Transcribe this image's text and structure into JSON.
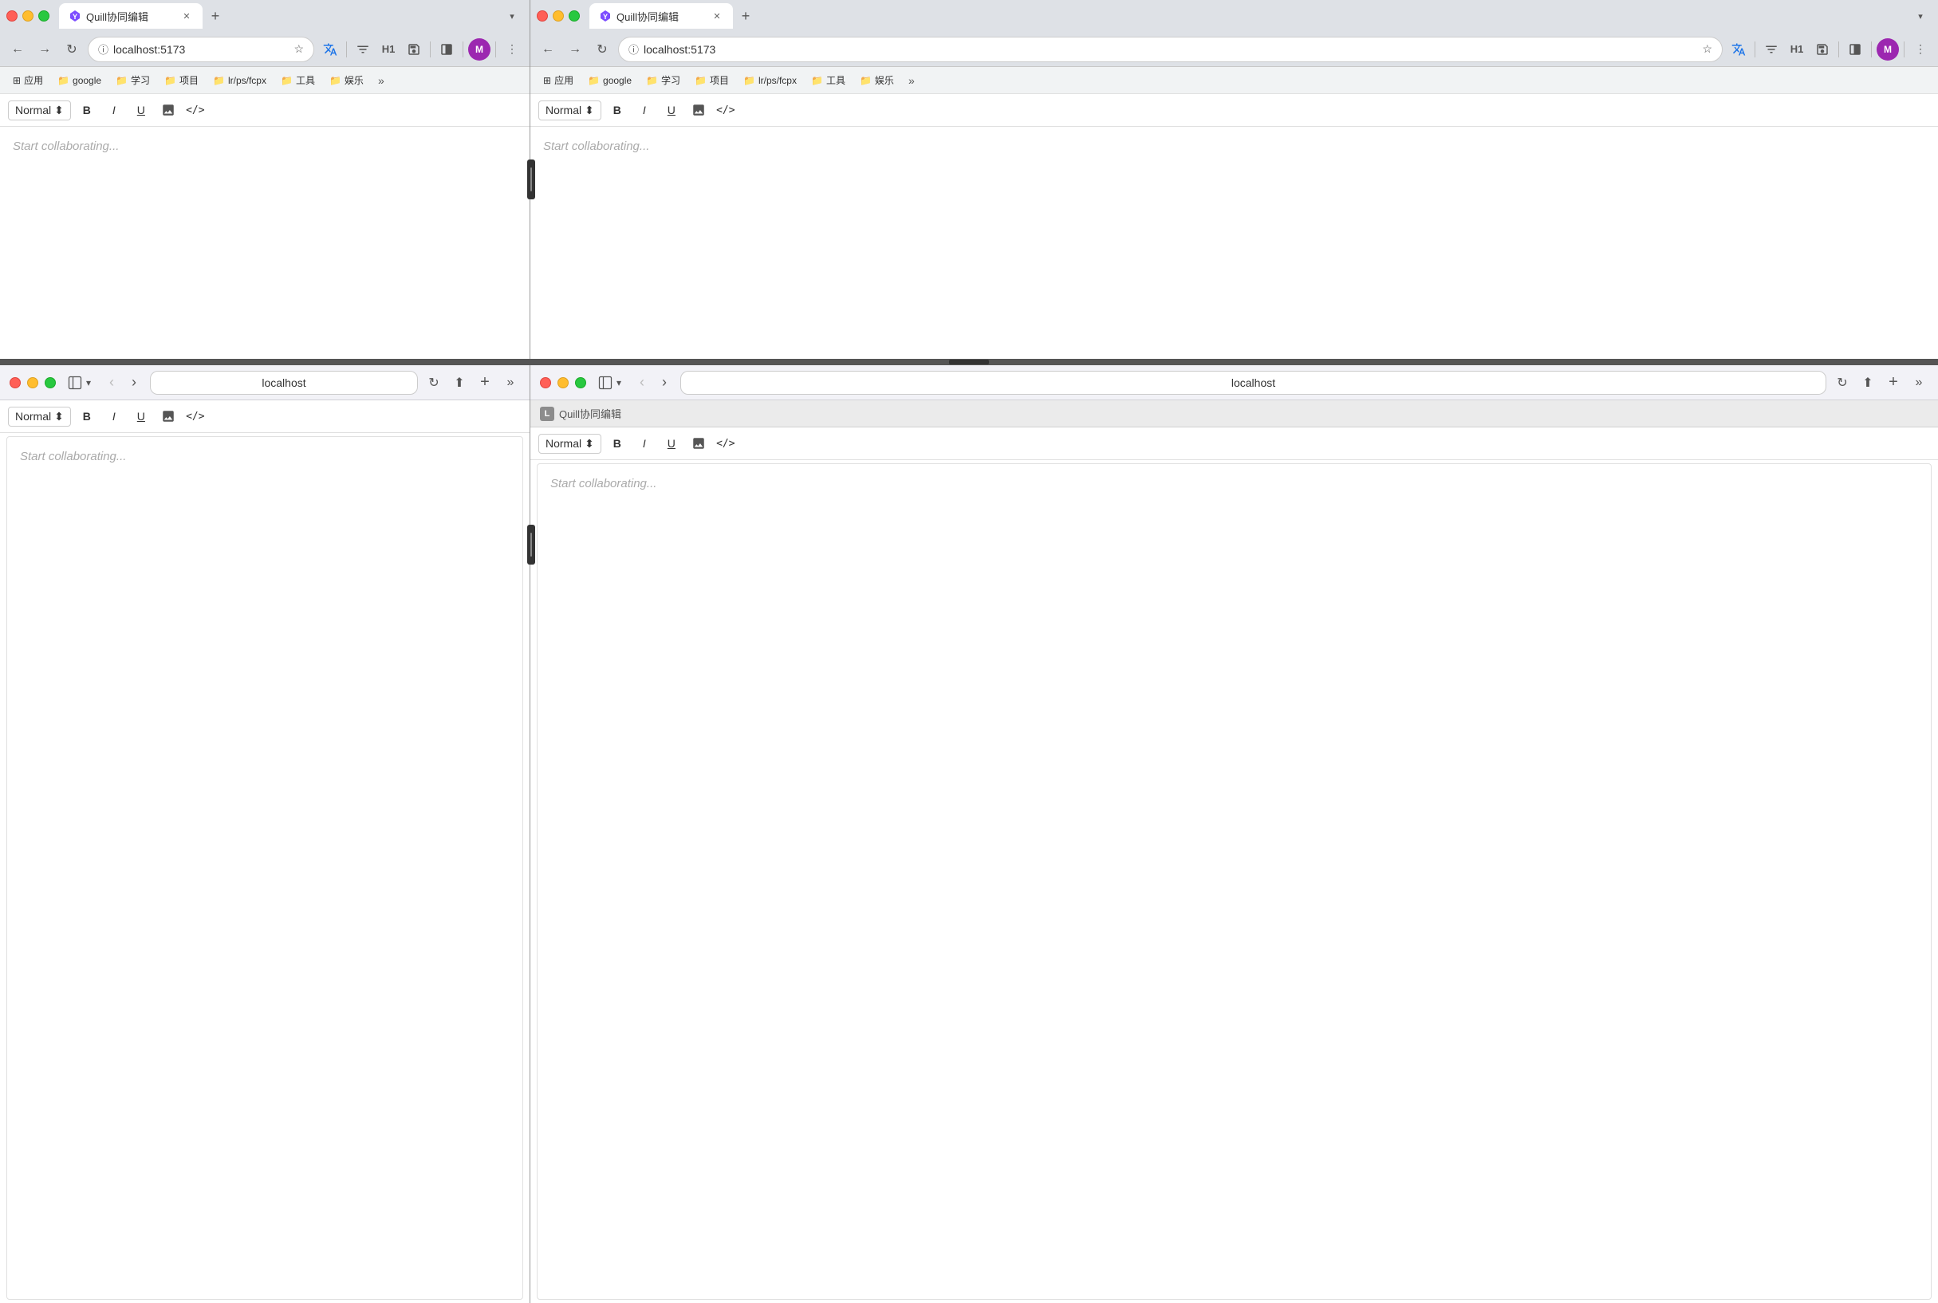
{
  "top_left": {
    "traffic_lights": [
      "red",
      "yellow",
      "green"
    ],
    "tab": {
      "title": "Quill协同编辑",
      "favicon": "Y"
    },
    "nav": {
      "url": "localhost:5173",
      "back_disabled": false,
      "forward_disabled": false
    },
    "bookmarks": [
      {
        "label": "应用",
        "icon": "⊞"
      },
      {
        "label": "google",
        "icon": "📁"
      },
      {
        "label": "学习",
        "icon": "📁"
      },
      {
        "label": "项目",
        "icon": "📁"
      },
      {
        "label": "lr/ps/fcpx",
        "icon": "📁"
      },
      {
        "label": "工具",
        "icon": "📁"
      },
      {
        "label": "娱乐",
        "icon": "📁"
      },
      {
        "label": "...",
        "icon": "»"
      }
    ],
    "toolbar": {
      "format": "Normal",
      "buttons": [
        "B",
        "I",
        "U",
        "🖼",
        "<>"
      ]
    },
    "editor": {
      "placeholder": "Start collaborating..."
    }
  },
  "top_right": {
    "traffic_lights": [
      "red",
      "yellow",
      "green"
    ],
    "tab": {
      "title": "Quill协同编辑",
      "favicon": "Y"
    },
    "nav": {
      "url": "localhost:5173",
      "back_disabled": false,
      "forward_disabled": false
    },
    "bookmarks": [
      {
        "label": "应用",
        "icon": "⊞"
      },
      {
        "label": "google",
        "icon": "📁"
      },
      {
        "label": "学习",
        "icon": "📁"
      },
      {
        "label": "项目",
        "icon": "📁"
      },
      {
        "label": "lr/ps/fcpx",
        "icon": "📁"
      },
      {
        "label": "工具",
        "icon": "📁"
      },
      {
        "label": "娱乐",
        "icon": "📁"
      },
      {
        "label": "...",
        "icon": "»"
      }
    ],
    "toolbar": {
      "format": "Normal",
      "buttons": [
        "B",
        "I",
        "U",
        "🖼",
        "<>"
      ]
    },
    "editor": {
      "placeholder": "Start collaborating..."
    }
  },
  "bottom_left": {
    "traffic_lights": [
      "red",
      "yellow",
      "green"
    ],
    "nav": {
      "url": "localhost"
    },
    "toolbar": {
      "format": "Normal",
      "buttons": [
        "B",
        "I",
        "U",
        "🖼",
        "<>"
      ]
    },
    "editor": {
      "placeholder": "Start collaborating..."
    }
  },
  "bottom_right": {
    "traffic_lights": [
      "red",
      "yellow",
      "green"
    ],
    "nav": {
      "url": "localhost"
    },
    "tab_bar": {
      "favicon": "L",
      "title": "Quill协同编辑"
    },
    "toolbar": {
      "format": "Normal",
      "buttons": [
        "B",
        "I",
        "U",
        "🖼",
        "<>"
      ]
    },
    "editor": {
      "placeholder": "Start collaborating..."
    }
  },
  "labels": {
    "bold": "B",
    "italic": "I",
    "underline": "U",
    "image": "🖼",
    "code": "</>",
    "normal": "Normal",
    "placeholder": "Start collaborating...",
    "more_bookmarks": "»"
  }
}
